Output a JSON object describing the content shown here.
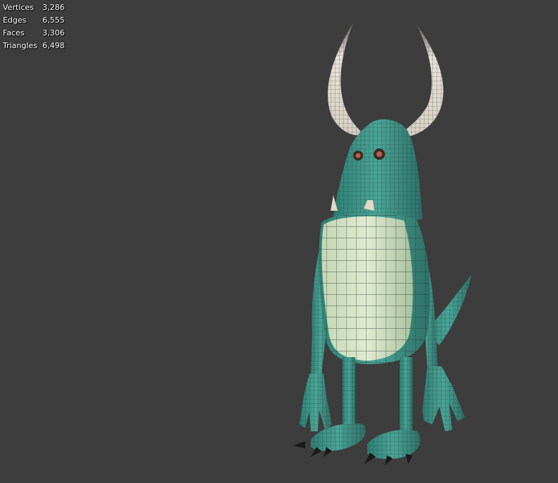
{
  "viewport": {
    "background": "#3d3d3d"
  },
  "stats": {
    "items": [
      {
        "label": "Vertices",
        "value": "3,286"
      },
      {
        "label": "Edges",
        "value": "6,555"
      },
      {
        "label": "Faces",
        "value": "3,306"
      },
      {
        "label": "Triangles",
        "value": "6,498"
      }
    ]
  },
  "model": {
    "colors": {
      "skin": "#3f9a8d",
      "skin_dark": "#2e6f66",
      "belly": "#d9e6c8",
      "horn": "#e8e2d6",
      "claw": "#1a1a1a",
      "wire": "#1c2a28"
    }
  }
}
